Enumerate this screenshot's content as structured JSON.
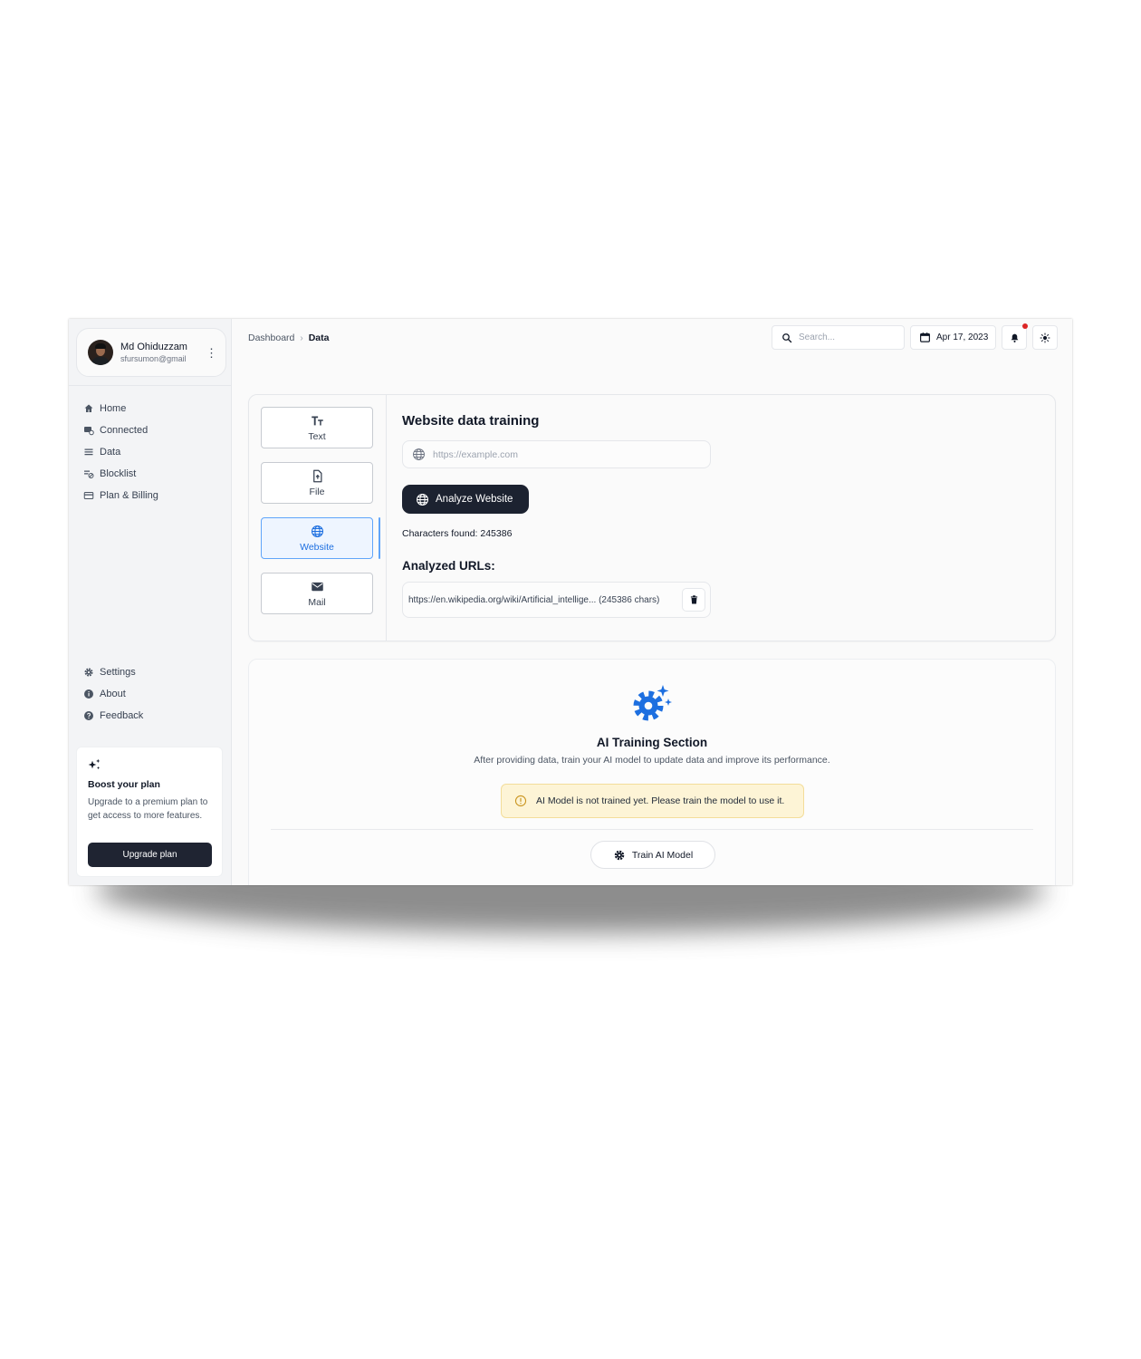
{
  "user": {
    "name": "Md Ohiduzzam",
    "email": "sfursumon@gmail"
  },
  "sidebar": {
    "nav_top": [
      {
        "label": "Home",
        "icon": "home-icon"
      },
      {
        "label": "Connected",
        "icon": "connected-icon"
      },
      {
        "label": "Data",
        "icon": "data-list-icon"
      },
      {
        "label": "Blocklist",
        "icon": "blocklist-icon"
      },
      {
        "label": "Plan & Billing",
        "icon": "billing-card-icon"
      }
    ],
    "nav_bottom": [
      {
        "label": "Settings",
        "icon": "gear-icon"
      },
      {
        "label": "About",
        "icon": "info-icon"
      },
      {
        "label": "Feedback",
        "icon": "question-icon"
      }
    ],
    "boost": {
      "title": "Boost your plan",
      "description": "Upgrade to a premium plan to get access to more features.",
      "button_label": "Upgrade plan"
    }
  },
  "breadcrumb": {
    "root": "Dashboard",
    "current": "Data"
  },
  "topbar": {
    "search_placeholder": "Search...",
    "date": "Apr 17, 2023"
  },
  "training": {
    "types": [
      {
        "label": "Text",
        "icon": "text-type-icon",
        "active": false
      },
      {
        "label": "File",
        "icon": "file-upload-icon",
        "active": false
      },
      {
        "label": "Website",
        "icon": "globe-icon",
        "active": true
      },
      {
        "label": "Mail",
        "icon": "mail-icon",
        "active": false
      }
    ],
    "title": "Website data training",
    "url_placeholder": "https://example.com",
    "analyze_label": "Analyze Website",
    "characters_found": "Characters found: 245386",
    "analyzed_title": "Analyzed URLs:",
    "analyzed_urls": [
      {
        "text": "https://en.wikipedia.org/wiki/Artificial_intellige... (245386 chars)"
      }
    ]
  },
  "ai_section": {
    "title": "AI Training Section",
    "description": "After providing data, train your AI model to update data and improve its performance.",
    "warning": "AI Model is not trained yet. Please train the model to use it.",
    "train_label": "Train AI Model"
  },
  "colors": {
    "accent": "#1d6fe0",
    "dark_button": "#1c2230",
    "warning_bg": "#fdf4d6",
    "notification": "#dc2626"
  }
}
